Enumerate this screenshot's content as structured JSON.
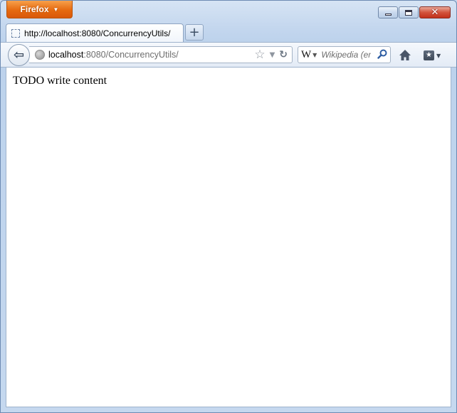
{
  "app": {
    "menu_button_label": "Firefox"
  },
  "tab": {
    "title": "http://localhost:8080/ConcurrencyUtils/"
  },
  "new_tab": {
    "label": "+"
  },
  "urlbar": {
    "host": "localhost",
    "path": ":8080/ConcurrencyUtils/"
  },
  "searchbar": {
    "engine_letter": "W",
    "placeholder": "Wikipedia (en"
  },
  "page": {
    "body_text": "TODO write content"
  },
  "colors": {
    "firefox_orange": "#e66a10",
    "chrome_blue": "#c3d6ee",
    "close_red": "#c2311b"
  },
  "icons": [
    "firefox-caret-icon",
    "minimize-icon",
    "maximize-icon",
    "close-icon",
    "favicon-placeholder-icon",
    "back-arrow-icon",
    "globe-icon",
    "bookmark-star-icon",
    "history-dropmarker-icon",
    "reload-icon",
    "wikipedia-icon",
    "search-magnifier-icon",
    "home-icon",
    "bookmarks-menu-icon"
  ]
}
